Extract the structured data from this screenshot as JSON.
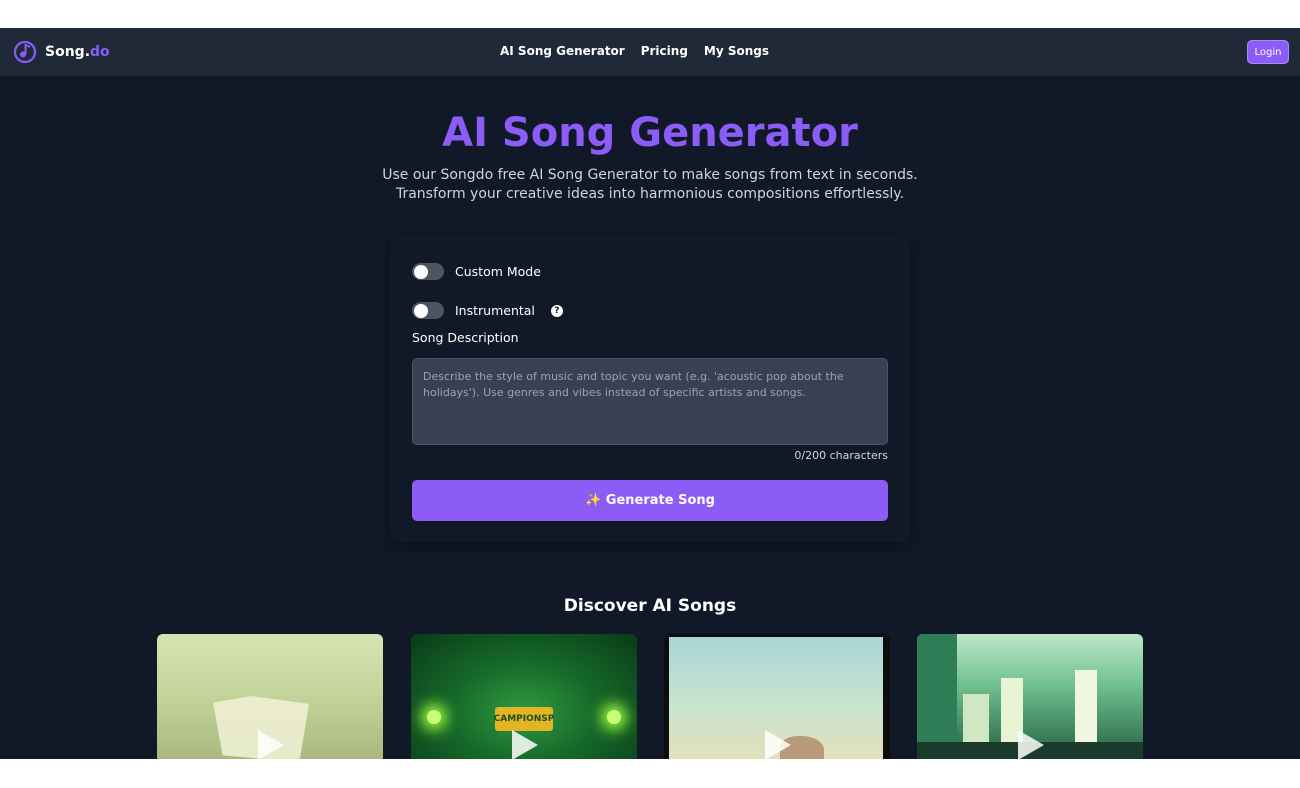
{
  "nav": {
    "logo_text": "Song.",
    "logo_accent": "do",
    "links": [
      "AI Song Generator",
      "Pricing",
      "My Songs"
    ],
    "login_label": "Login"
  },
  "hero": {
    "title": "AI Song Generator",
    "subtitle_line1": "Use our Songdo free AI Song Generator to make songs from text in seconds.",
    "subtitle_line2": "Transform your creative ideas into harmonious compositions effortlessly."
  },
  "form": {
    "custom_mode_label": "Custom Mode",
    "custom_mode_on": false,
    "instrumental_label": "Instrumental",
    "instrumental_on": false,
    "help_glyph": "?",
    "description_label": "Song Description",
    "description_placeholder": "Describe the style of music and topic you want (e.g. 'acoustic pop about the holidays'). Use genres and vibes instead of specific artists and songs.",
    "char_count": "0/200 characters",
    "generate_label": "✨ Generate Song"
  },
  "discover": {
    "title": "Discover AI Songs",
    "cards": [
      {
        "art": "white-flag-field"
      },
      {
        "art": "championship-stadium",
        "sign_text": "CAMPIONSP"
      },
      {
        "art": "rock-landscape"
      },
      {
        "art": "green-city-car"
      }
    ]
  },
  "colors": {
    "accent": "#8b5cf6",
    "page_bg": "#111827",
    "nav_bg": "#1f2937",
    "input_bg": "#374151"
  }
}
